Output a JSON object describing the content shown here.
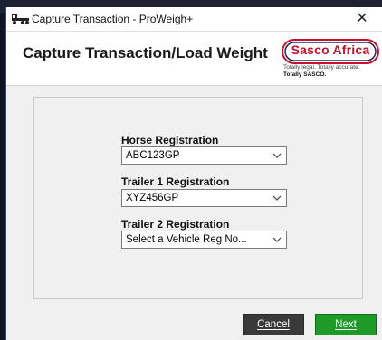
{
  "window": {
    "title": "Capture Transaction - ProWeigh+",
    "close_glyph": "✕"
  },
  "header": {
    "page_title": "Capture Transaction/Load Weight",
    "logo_text": "Sasco Africa",
    "tagline_1": "Totally legal. Totally accurate.",
    "tagline_2": "Totally SASCO."
  },
  "form": {
    "horse": {
      "label": "Horse Registration",
      "value": "ABC123GP"
    },
    "trailer1": {
      "label": "Trailer 1 Registration",
      "value": "XYZ456GP"
    },
    "trailer2": {
      "label": "Trailer 2 Registration",
      "value": "Select a Vehicle Reg No..."
    }
  },
  "buttons": {
    "cancel": "Cancel",
    "next": "Next"
  },
  "colors": {
    "brand_red": "#c8102e",
    "next_green": "#1f9a29",
    "cancel_dark": "#3a3a3a"
  },
  "icons": {
    "app": "truck-icon",
    "close": "close-icon",
    "dropdown": "chevron-down-icon"
  }
}
